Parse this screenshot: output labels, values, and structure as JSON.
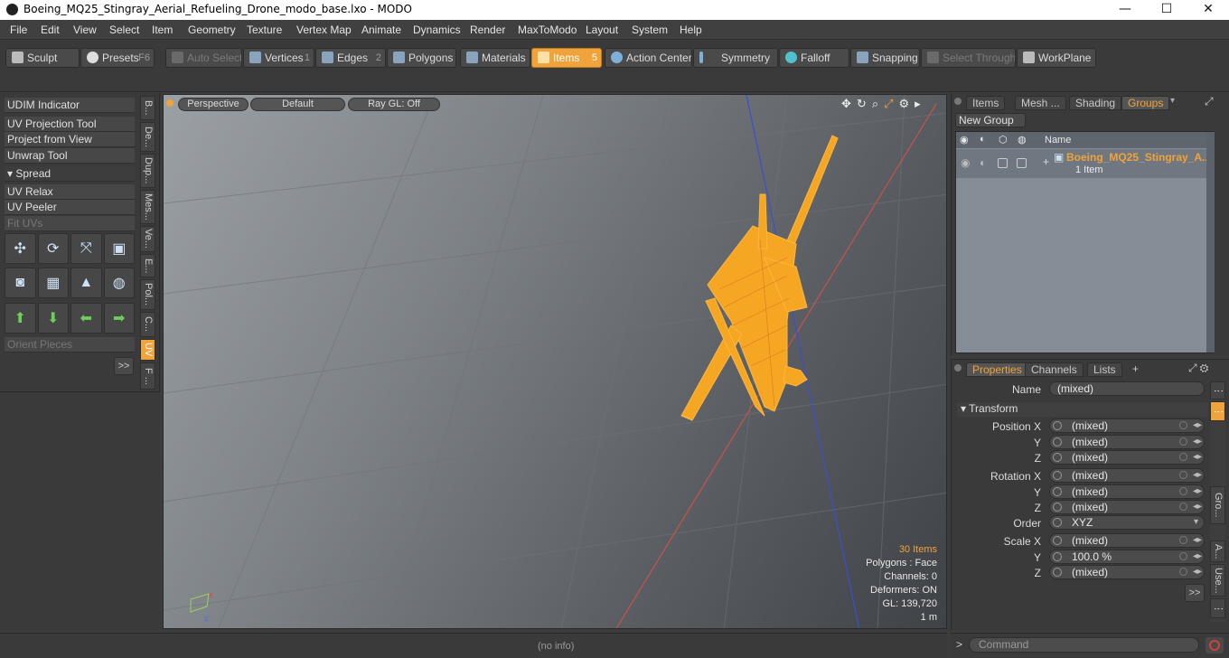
{
  "window": {
    "title": "Boeing_MQ25_Stingray_Aerial_Refueling_Drone_modo_base.lxo - MODO",
    "minimize": "—",
    "maximize": "☐",
    "close": "✕"
  },
  "menu": [
    "File",
    "Edit",
    "View",
    "Select",
    "Item",
    "Geometry",
    "Texture",
    "Vertex Map",
    "Animate",
    "Dynamics",
    "Render",
    "MaxToModo",
    "Layout",
    "System",
    "Help"
  ],
  "toolbar": {
    "sculpt": "Sculpt",
    "presets": "Presets",
    "presets_hotkey": "F6",
    "auto_select": "Auto Select",
    "vertices": "Vertices",
    "vertices_num": "1",
    "edges": "Edges",
    "edges_num": "2",
    "polygons": "Polygons",
    "materials": "Materials",
    "items": "Items",
    "items_num": "5",
    "action_center": "Action Center",
    "symmetry": "Symmetry",
    "falloff": "Falloff",
    "snapping": "Snapping",
    "select_through": "Select Through",
    "workplane": "WorkPlane"
  },
  "left_tools": {
    "udim": "UDIM Indicator",
    "uv_projection": "UV Projection Tool",
    "project_view": "Project from View",
    "unwrap": "Unwrap Tool",
    "spread": "Spread",
    "uv_relax": "UV Relax",
    "uv_peeler": "UV Peeler",
    "fit_uvs": "Fit UVs",
    "orient": "Orient Pieces",
    "more": ">>"
  },
  "vtabs": [
    "B...",
    "De...",
    "Dup...",
    "Mes...",
    "Ve...",
    "E...",
    "Pol...",
    "C...",
    "UV",
    "F ..."
  ],
  "viewport": {
    "perspective": "Perspective",
    "default": "Default",
    "raygl": "Ray GL: Off",
    "info": {
      "items": "30 Items",
      "polygons": "Polygons : Face",
      "channels": "Channels: 0",
      "deformers": "Deformers: ON",
      "gl": "GL: 139,720",
      "scale": "1 m"
    }
  },
  "status": "(no info)",
  "right_top": {
    "tabs": [
      "Items",
      "Mesh ...",
      "Shading",
      "Groups"
    ],
    "new_group": "New Group",
    "name_col": "Name",
    "group_name": "Boeing_MQ25_Stingray_A...",
    "group_count": "1 Item"
  },
  "right_bottom": {
    "tabs": [
      "Properties",
      "Channels",
      "Lists"
    ],
    "add_tab": "+",
    "name_label": "Name",
    "name_value": "(mixed)",
    "transform": "Transform",
    "position_x": "Position X",
    "y": "Y",
    "z": "Z",
    "rotation_x": "Rotation X",
    "order": "Order",
    "order_value": "XYZ",
    "scale_x": "Scale X",
    "mixed": "(mixed)",
    "scale_y": "100.0 %",
    "side_tabs": [
      "Gro...",
      "A...",
      "Use..."
    ],
    "more": ">>"
  },
  "command": {
    "placeholder": "Command",
    "prompt": ">"
  },
  "colors": {
    "accent": "#f0a33a",
    "model": "#f5a623"
  }
}
